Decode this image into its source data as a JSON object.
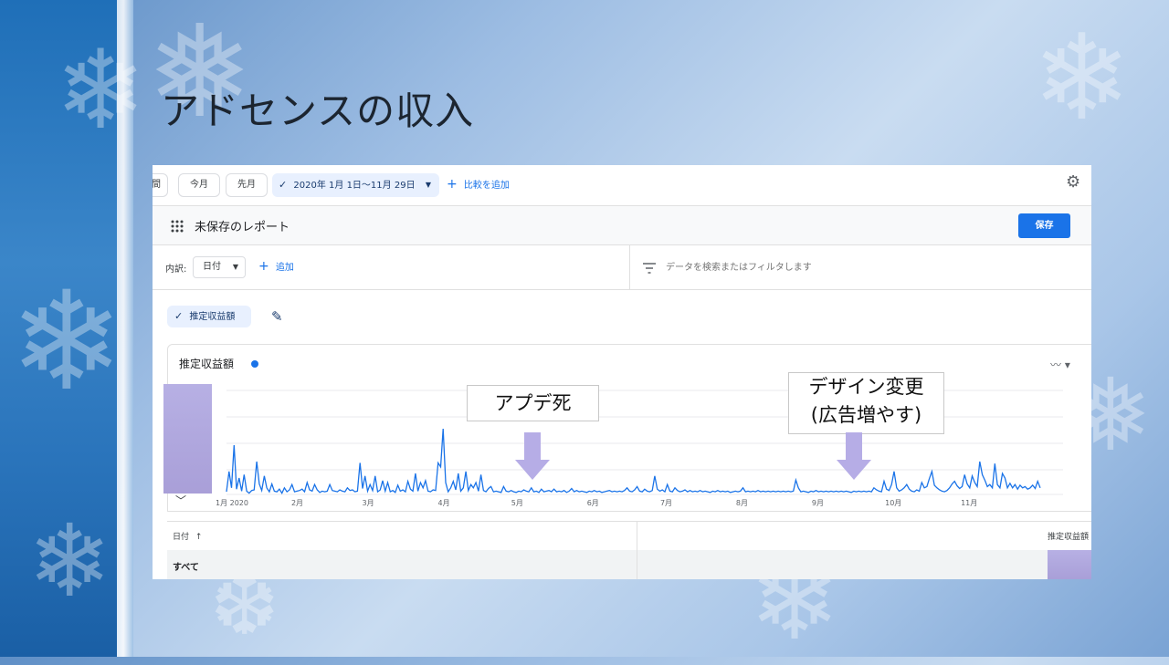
{
  "slide": {
    "title": "アドセンスの収入"
  },
  "toolbar": {
    "period_partial": "間",
    "this_month": "今月",
    "last_month": "先月",
    "date_range": "2020年 1月 1日～11月 29日",
    "compare_label": "比較を追加"
  },
  "report": {
    "name": "未保存のレポート",
    "save_label": "保存"
  },
  "breakdown": {
    "label": "内訳:",
    "dimension": "日付",
    "add_label": "追加",
    "filter_placeholder": "データを検索またはフィルタします"
  },
  "metric": {
    "chip_label": "推定収益額"
  },
  "chart": {
    "title": "推定収益額"
  },
  "table": {
    "date_header": "日付",
    "metric_header": "推定収益額",
    "total_label": "すべて"
  },
  "annotations": [
    {
      "lines": [
        "アプデ死"
      ]
    },
    {
      "lines": [
        "デザイン変更",
        "(広告増やす)"
      ]
    }
  ],
  "colors": {
    "accent": "#1a73e8",
    "line": "#1a73e8",
    "arrow": "#b6ade6"
  },
  "chart_data": {
    "type": "line",
    "title": "推定収益額",
    "x_tick_labels": [
      "1月 2020",
      "2月",
      "3月",
      "4月",
      "5月",
      "6月",
      "7月",
      "8月",
      "9月",
      "10月",
      "11月"
    ],
    "x_range": [
      "2020-01-01",
      "2020-11-29"
    ],
    "grid": true,
    "series": [
      {
        "values": [
          0.04,
          0.35,
          0.1,
          0.75,
          0.08,
          0.25,
          0.05,
          0.3,
          0.05,
          0.02,
          0.06,
          0.07,
          0.5,
          0.16,
          0.06,
          0.28,
          0.1,
          0.04,
          0.16,
          0.05,
          0.04,
          0.08,
          0.02,
          0.1,
          0.04,
          0.07,
          0.15,
          0.04,
          0.05,
          0.06,
          0.08,
          0.04,
          0.18,
          0.07,
          0.05,
          0.15,
          0.07,
          0.03,
          0.05,
          0.04,
          0.05,
          0.15,
          0.06,
          0.05,
          0.04,
          0.07,
          0.05,
          0.04,
          0.1,
          0.06,
          0.07,
          0.04,
          0.05,
          0.48,
          0.09,
          0.28,
          0.05,
          0.15,
          0.06,
          0.28,
          0.04,
          0.07,
          0.21,
          0.05,
          0.18,
          0.04,
          0.06,
          0.03,
          0.14,
          0.05,
          0.07,
          0.04,
          0.2,
          0.08,
          0.05,
          0.32,
          0.05,
          0.18,
          0.1,
          0.21,
          0.05,
          0.04,
          0.07,
          0.06,
          0.48,
          0.42,
          1.0,
          0.18,
          0.04,
          0.1,
          0.2,
          0.07,
          0.32,
          0.05,
          0.1,
          0.35,
          0.06,
          0.15,
          0.1,
          0.18,
          0.05,
          0.3,
          0.06,
          0.04,
          0.09,
          0.12,
          0.04,
          0.05,
          0.04,
          0.03,
          0.12,
          0.05,
          0.04,
          0.06,
          0.04,
          0.03,
          0.05,
          0.04,
          0.07,
          0.05,
          0.04,
          0.1,
          0.04,
          0.05,
          0.03,
          0.08,
          0.04,
          0.05,
          0.06,
          0.04,
          0.08,
          0.04,
          0.05,
          0.04,
          0.06,
          0.03,
          0.05,
          0.09,
          0.04,
          0.06,
          0.04,
          0.05,
          0.04,
          0.03,
          0.05,
          0.04,
          0.06,
          0.04,
          0.05,
          0.03,
          0.04,
          0.05,
          0.06,
          0.04,
          0.05,
          0.04,
          0.05,
          0.04,
          0.06,
          0.1,
          0.05,
          0.04,
          0.07,
          0.12,
          0.05,
          0.04,
          0.08,
          0.05,
          0.04,
          0.06,
          0.28,
          0.08,
          0.05,
          0.07,
          0.04,
          0.15,
          0.05,
          0.04,
          0.1,
          0.06,
          0.04,
          0.05,
          0.07,
          0.04,
          0.06,
          0.04,
          0.05,
          0.04,
          0.06,
          0.04,
          0.05,
          0.04,
          0.03,
          0.05,
          0.04,
          0.06,
          0.04,
          0.05,
          0.04,
          0.05,
          0.03,
          0.04,
          0.05,
          0.04,
          0.05,
          0.1,
          0.04,
          0.05,
          0.04,
          0.05,
          0.04,
          0.06,
          0.04,
          0.05,
          0.04,
          0.05,
          0.04,
          0.05,
          0.04,
          0.05,
          0.04,
          0.05,
          0.04,
          0.05,
          0.04,
          0.05,
          0.22,
          0.1,
          0.04,
          0.05,
          0.04,
          0.03,
          0.05,
          0.04,
          0.06,
          0.04,
          0.05,
          0.04,
          0.05,
          0.04,
          0.05,
          0.04,
          0.05,
          0.04,
          0.05,
          0.04,
          0.05,
          0.04,
          0.03,
          0.05,
          0.04,
          0.05,
          0.04,
          0.05,
          0.04,
          0.05,
          0.04,
          0.1,
          0.07,
          0.05,
          0.04,
          0.2,
          0.08,
          0.06,
          0.15,
          0.35,
          0.1,
          0.05,
          0.07,
          0.1,
          0.15,
          0.08,
          0.05,
          0.04,
          0.07,
          0.05,
          0.18,
          0.1,
          0.12,
          0.24,
          0.35,
          0.14,
          0.1,
          0.07,
          0.05,
          0.04,
          0.06,
          0.1,
          0.16,
          0.2,
          0.13,
          0.09,
          0.12,
          0.3,
          0.16,
          0.1,
          0.28,
          0.18,
          0.12,
          0.5,
          0.3,
          0.22,
          0.12,
          0.15,
          0.1,
          0.47,
          0.15,
          0.1,
          0.32,
          0.25,
          0.1,
          0.17,
          0.1,
          0.15,
          0.08,
          0.14,
          0.1,
          0.12,
          0.08,
          0.1,
          0.14,
          0.09,
          0.2,
          0.1
        ]
      }
    ]
  }
}
